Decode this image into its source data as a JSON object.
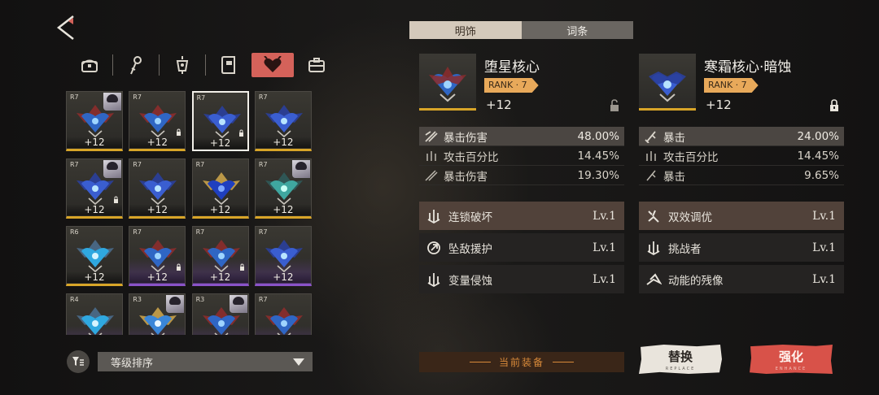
{
  "grid": {
    "cards": [
      {
        "rank": "R7",
        "level": "+12",
        "gem": "red-blue",
        "portrait": true,
        "locked": false,
        "bar": "gold"
      },
      {
        "rank": "R7",
        "level": "+12",
        "gem": "red-blue",
        "portrait": false,
        "locked": true,
        "bar": "gold"
      },
      {
        "rank": "R7",
        "level": "+12",
        "gem": "blue",
        "portrait": false,
        "locked": true,
        "bar": "gold",
        "selected": true
      },
      {
        "rank": "R7",
        "level": "+12",
        "gem": "blue",
        "portrait": false,
        "locked": false,
        "bar": "gold"
      },
      {
        "rank": "R7",
        "level": "+12",
        "gem": "blue",
        "portrait": true,
        "locked": true,
        "bar": "gold"
      },
      {
        "rank": "R7",
        "level": "+12",
        "gem": "blue",
        "portrait": false,
        "locked": false,
        "bar": "gold"
      },
      {
        "rank": "R7",
        "level": "+12",
        "gem": "sapphire",
        "portrait": false,
        "locked": false,
        "bar": "gold"
      },
      {
        "rank": "R7",
        "level": "+12",
        "gem": "teal",
        "portrait": true,
        "locked": false,
        "bar": "gold"
      },
      {
        "rank": "R6",
        "level": "+12",
        "gem": "cyan",
        "portrait": false,
        "locked": false,
        "bar": "gold"
      },
      {
        "rank": "R7",
        "level": "+12",
        "gem": "red-blue",
        "portrait": false,
        "locked": true,
        "bar": "purple"
      },
      {
        "rank": "R7",
        "level": "+12",
        "gem": "red-blue",
        "portrait": false,
        "locked": true,
        "bar": "purple"
      },
      {
        "rank": "R7",
        "level": "+12",
        "gem": "blue",
        "portrait": false,
        "locked": false,
        "bar": "purple"
      },
      {
        "rank": "R4",
        "level": "",
        "gem": "cyan",
        "portrait": false,
        "locked": false,
        "bar": "purple"
      },
      {
        "rank": "R3",
        "level": "",
        "gem": "gold",
        "portrait": true,
        "locked": false,
        "bar": "purple"
      },
      {
        "rank": "R3",
        "level": "",
        "gem": "red-blue",
        "portrait": true,
        "locked": false,
        "bar": "purple"
      },
      {
        "rank": "R7",
        "level": "",
        "gem": "red-blue",
        "portrait": false,
        "locked": false,
        "bar": "purple"
      }
    ]
  },
  "sort": {
    "label": "等级排序"
  },
  "tabs": {
    "tab1": "明饰",
    "tab2": "词条"
  },
  "left_item": {
    "name": "堕星核心",
    "rank": "RANK · 7",
    "level": "+12",
    "stats": [
      {
        "name": "暴击伤害",
        "value": "48.00%"
      },
      {
        "name": "攻击百分比",
        "value": "14.45%"
      },
      {
        "name": "暴击伤害",
        "value": "19.30%"
      }
    ],
    "skills": [
      {
        "name": "连锁破坏",
        "level": "Lv.1"
      },
      {
        "name": "坠敌援护",
        "level": "Lv.1"
      },
      {
        "name": "变量侵蚀",
        "level": "Lv.1"
      }
    ]
  },
  "right_item": {
    "name": "寒霜核心·暗蚀",
    "rank": "RANK · 7",
    "level": "+12",
    "stats": [
      {
        "name": "暴击",
        "value": "24.00%"
      },
      {
        "name": "攻击百分比",
        "value": "14.45%"
      },
      {
        "name": "暴击",
        "value": "9.65%"
      }
    ],
    "skills": [
      {
        "name": "双效调优",
        "level": "Lv.1"
      },
      {
        "name": "挑战者",
        "level": "Lv.1"
      },
      {
        "name": "动能的残像",
        "level": "Lv.1"
      }
    ]
  },
  "equipped_label": "当前装备",
  "buttons": {
    "replace": "替换",
    "replace_sub": "REPLACE",
    "enhance": "强化",
    "enhance_sub": "ENHANCE"
  },
  "colors": {
    "accent": "#d4625a",
    "gold_bar": "#d8a528",
    "purple_bar": "#8a52c8",
    "rank_tag": "#e8a95a",
    "enhance": "#d85249"
  }
}
